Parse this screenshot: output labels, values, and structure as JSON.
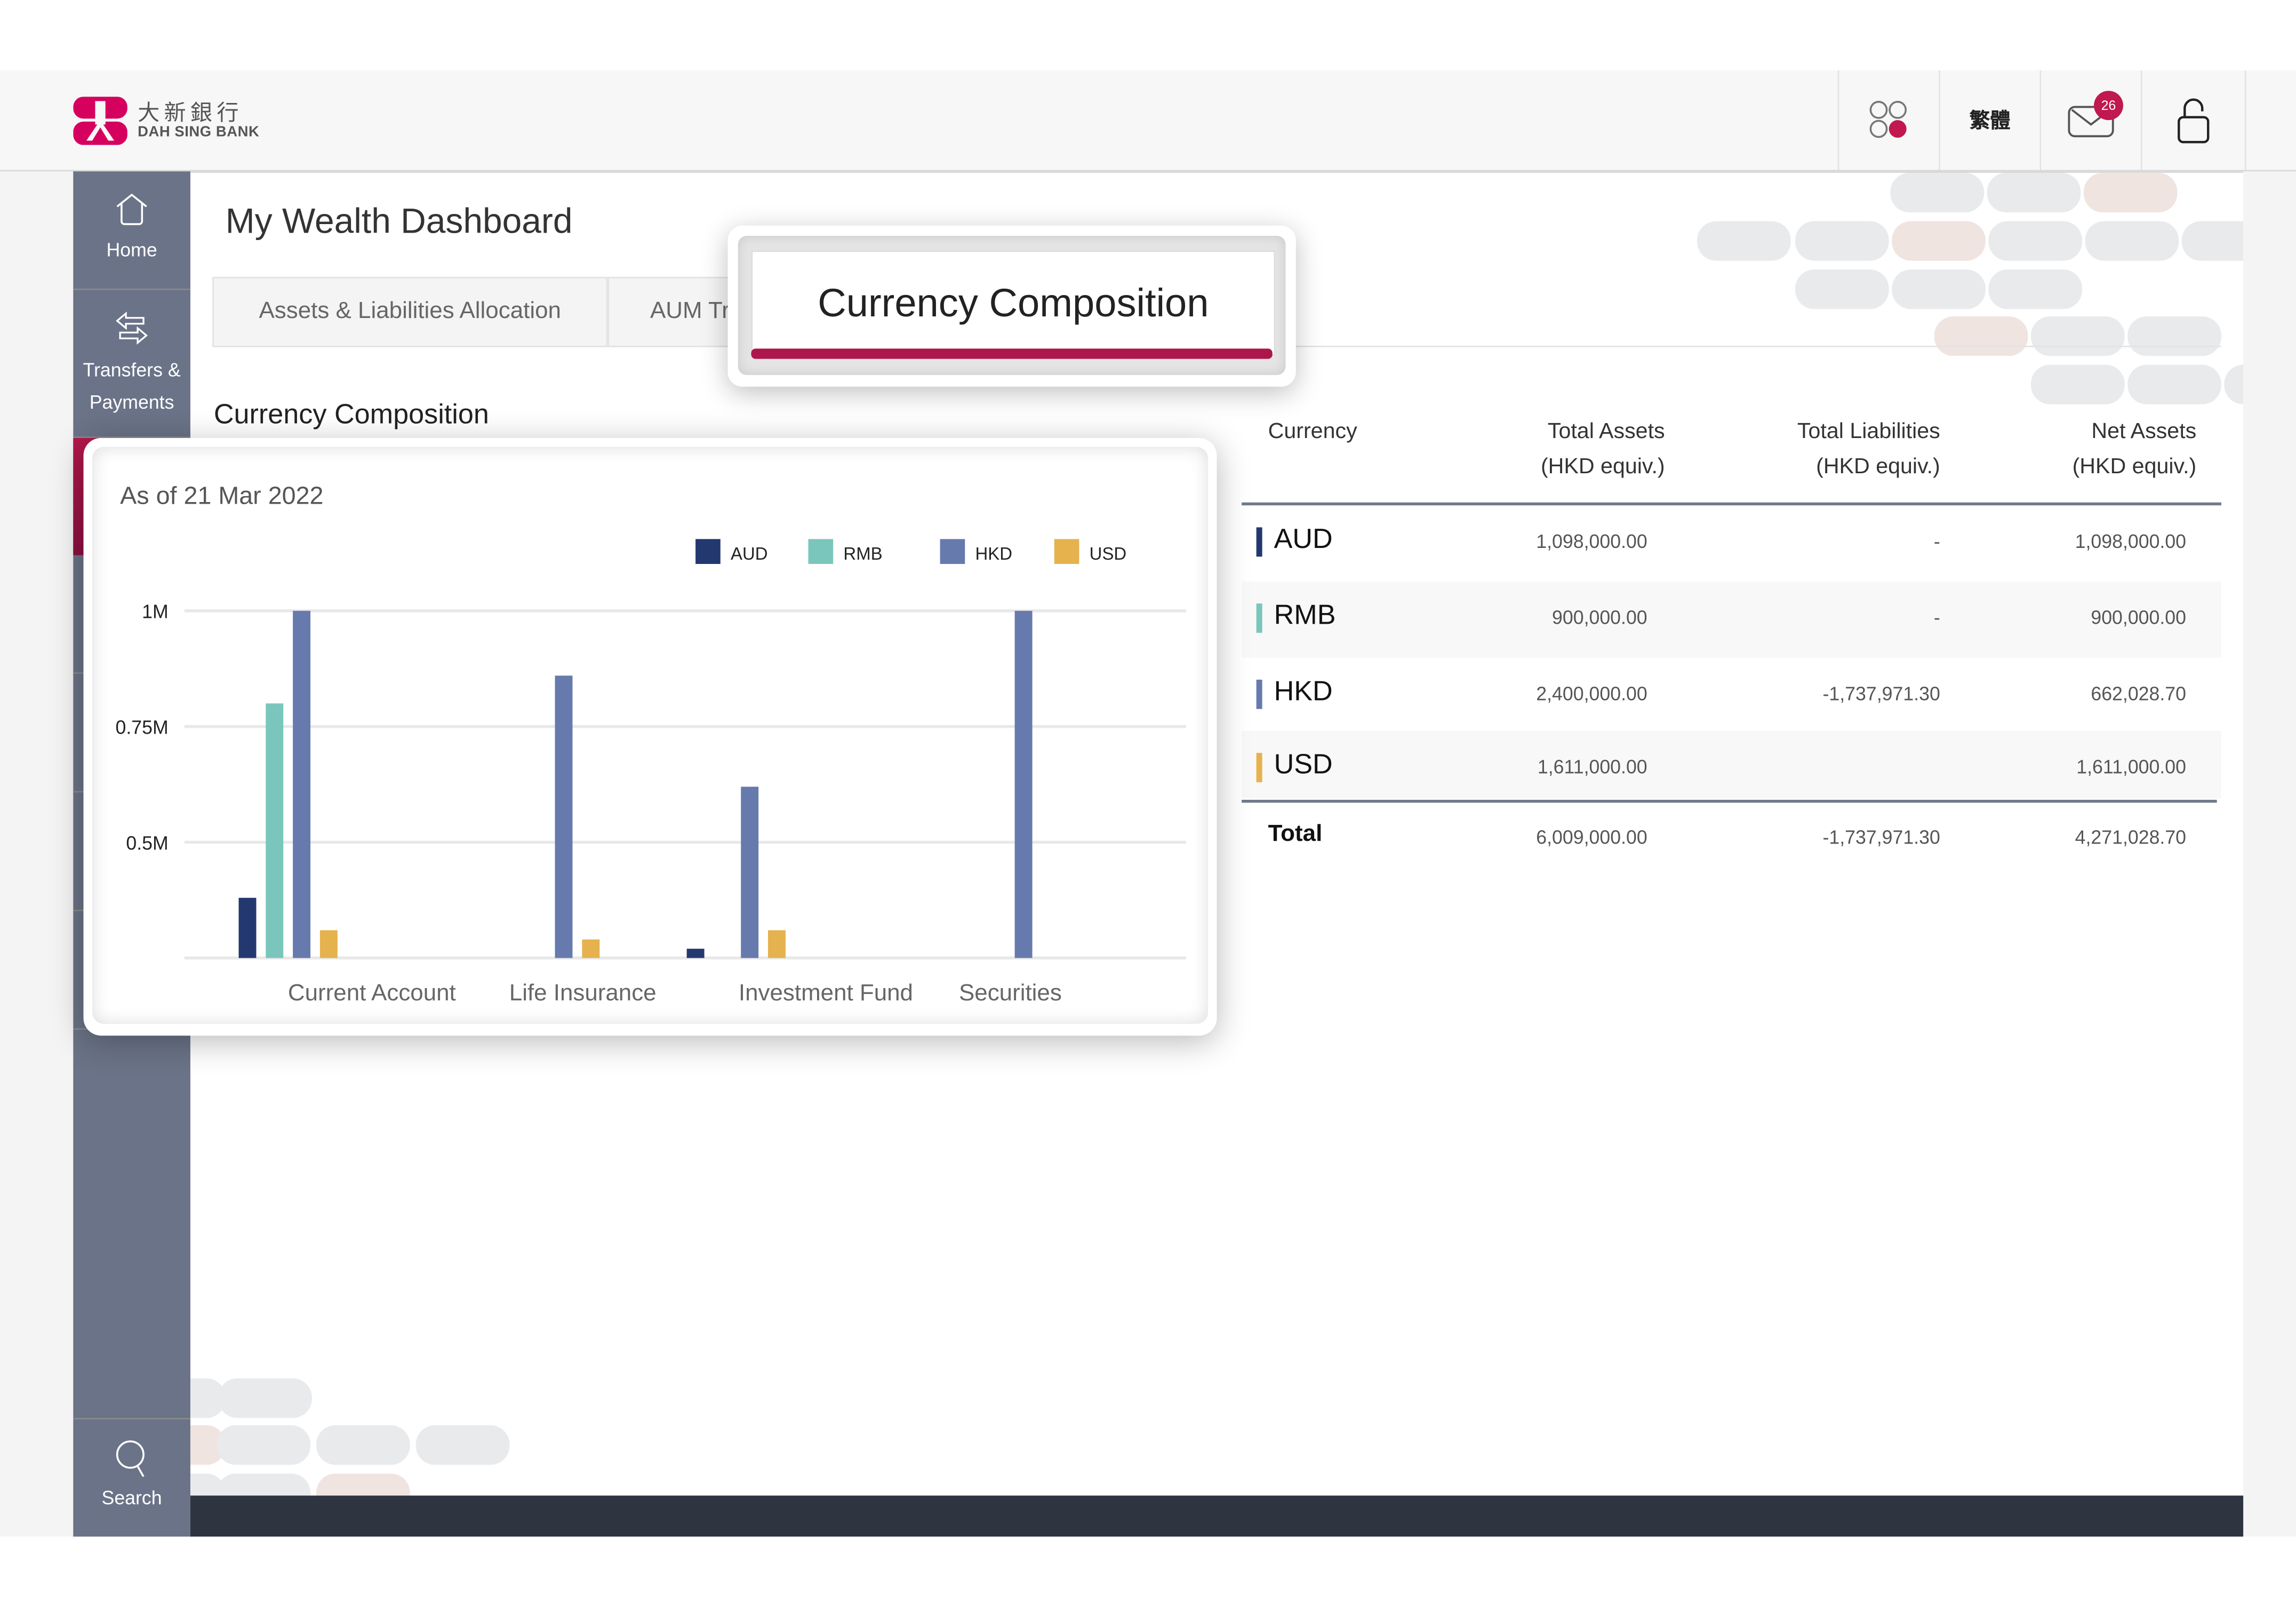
{
  "header": {
    "logo_cn": "大新銀行",
    "logo_en": "DAH SING BANK",
    "language_toggle": "繁體",
    "mail_badge_count": "26",
    "icons": [
      "apps-icon",
      "mail-icon",
      "unlock-icon"
    ]
  },
  "sidebar": {
    "items": [
      {
        "label": "Home",
        "icon": "home-icon"
      },
      {
        "label": "Transfers & Payments",
        "icon": "transfer-icon"
      },
      {
        "label": "Search",
        "icon": "search-icon"
      }
    ]
  },
  "page": {
    "title": "My Wealth Dashboard",
    "tabs": [
      {
        "label": "Assets & Liabilities Allocation"
      },
      {
        "label": "AUM Tre"
      },
      {
        "label": "Currency Composition",
        "active": true
      }
    ],
    "section_title": "Currency Composition",
    "as_of": "As of 21 Mar 2022"
  },
  "colors": {
    "brand": "#c0184f",
    "AUD": "#22386f",
    "RMB": "#7ac6bd",
    "HKD": "#677aae",
    "USD": "#e5b24e"
  },
  "chart_data": {
    "type": "bar",
    "title": "",
    "categories": [
      "Current Account",
      "Life Insurance",
      "Investment Fund",
      "Securities"
    ],
    "series": [
      {
        "name": "AUD",
        "values": [
          0.38,
          null,
          0.27,
          null
        ]
      },
      {
        "name": "RMB",
        "values": [
          0.8,
          null,
          null,
          null
        ]
      },
      {
        "name": "HKD",
        "values": [
          1.0,
          0.86,
          0.62,
          1.0
        ]
      },
      {
        "name": "USD",
        "values": [
          0.31,
          0.29,
          0.31,
          null
        ]
      }
    ],
    "units": "M (HKD equiv.)",
    "yticks": [
      "1M",
      "0.75M",
      "0.5M"
    ],
    "ytick_values": [
      1.0,
      0.75,
      0.5
    ],
    "ylim": [
      0.25,
      1.0
    ],
    "grid": true,
    "legend": "top-right",
    "xlabel": "",
    "ylabel": ""
  },
  "table": {
    "headers": [
      {
        "line1": "Currency",
        "line2": ""
      },
      {
        "line1": "Total Assets",
        "line2": "(HKD equiv.)"
      },
      {
        "line1": "Total Liabilities",
        "line2": "(HKD equiv.)"
      },
      {
        "line1": "Net Assets",
        "line2": "(HKD equiv.)"
      }
    ],
    "rows": [
      {
        "currency": "AUD",
        "total_assets": "1,098,000.00",
        "total_liabilities": "-",
        "net_assets": "1,098,000.00"
      },
      {
        "currency": "RMB",
        "total_assets": "900,000.00",
        "total_liabilities": "-",
        "net_assets": "900,000.00"
      },
      {
        "currency": "HKD",
        "total_assets": "2,400,000.00",
        "total_liabilities": "-1,737,971.30",
        "net_assets": "662,028.70"
      },
      {
        "currency": "USD",
        "total_assets": "1,611,000.00",
        "total_liabilities": "",
        "net_assets": "1,611,000.00"
      }
    ],
    "total": {
      "label": "Total",
      "total_assets": "6,009,000.00",
      "total_liabilities": "-1,737,971.30",
      "net_assets": "4,271,028.70"
    }
  }
}
